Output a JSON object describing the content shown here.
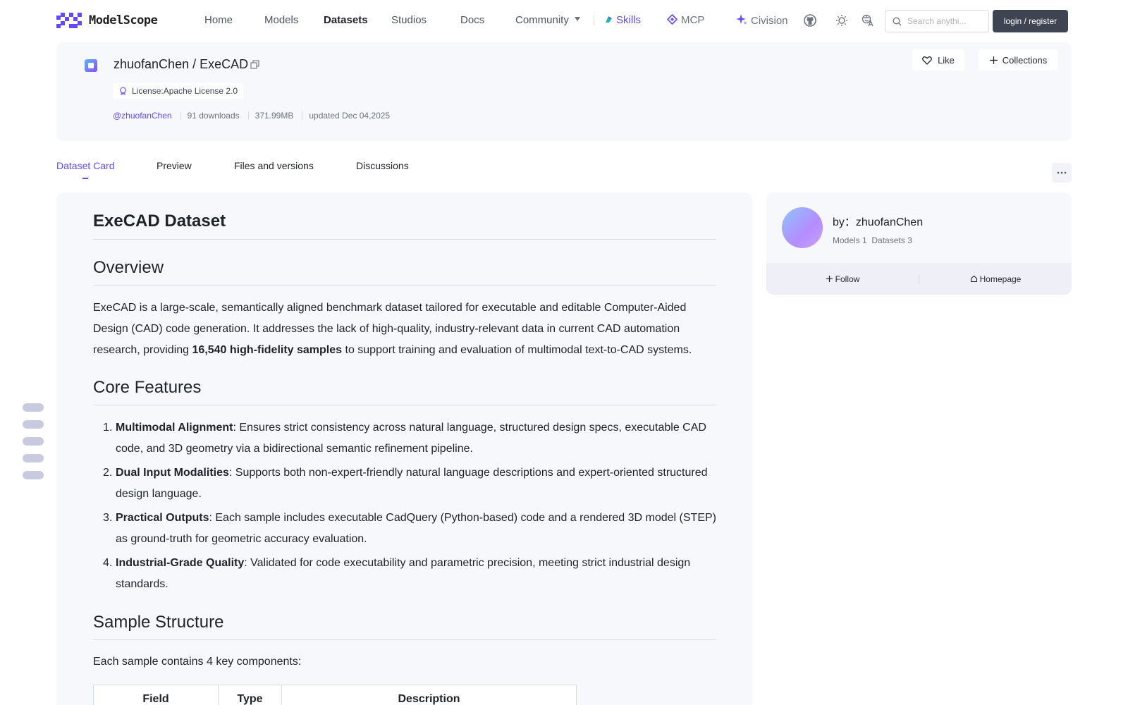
{
  "brand": {
    "name": "ModelScope",
    "accent": "#624aff"
  },
  "nav": {
    "home": "Home",
    "models": "Models",
    "datasets": "Datasets",
    "studios": "Studios",
    "docs": "Docs",
    "community": "Community",
    "skills": "Skills",
    "mcp": "MCP",
    "civision": "Civision",
    "search_placeholder": "Search anythi...",
    "login": "login / register"
  },
  "header": {
    "owner": "zhuofanChen",
    "separator": "/",
    "name": "ExeCAD",
    "license": "License:Apache License 2.0",
    "author_link": "@zhuofanChen",
    "downloads": "91 downloads",
    "size": "371.99MB",
    "updated": "updated Dec 04,2025",
    "like_label": "Like",
    "collections_label": "Collections"
  },
  "tabs": [
    {
      "label": "Dataset Card",
      "active": true
    },
    {
      "label": "Preview"
    },
    {
      "label": "Files and versions"
    },
    {
      "label": "Discussions"
    }
  ],
  "readme": {
    "title": "ExeCAD Dataset",
    "overview_heading": "Overview",
    "overview_before": "ExeCAD is a large-scale, semantically aligned benchmark dataset tailored for executable and editable Computer-Aided Design (CAD) code generation. It addresses the lack of high-quality, industry-relevant data in current CAD automation research, providing ",
    "overview_bold": "16,540 high-fidelity samples",
    "overview_after": " to support training and evaluation of multimodal text-to-CAD systems.",
    "features_heading": "Core Features",
    "features": [
      {
        "num": "1.",
        "title": "Multimodal Alignment",
        "text": ": Ensures strict consistency across natural language, structured design specs, executable CAD code, and 3D geometry via a bidirectional semantic refinement pipeline."
      },
      {
        "num": "2.",
        "title": "Dual Input Modalities",
        "text": ": Supports both non-expert-friendly natural language descriptions and expert-oriented structured design language."
      },
      {
        "num": "3.",
        "title": "Practical Outputs",
        "text": ": Each sample includes executable CadQuery (Python-based) code and a rendered 3D model (STEP) as ground-truth for geometric accuracy evaluation."
      },
      {
        "num": "4.",
        "title": "Industrial-Grade Quality",
        "text": ": Validated for code executability and parametric precision, meeting strict industrial design standards."
      }
    ],
    "structure_heading": "Sample Structure",
    "structure_text": "Each sample contains 4 key components:",
    "table_headers": [
      "Field",
      "Type",
      "Description"
    ]
  },
  "author": {
    "by_label": "by：",
    "name": "zhuofanChen",
    "models": "Models 1",
    "datasets": "Datasets 3",
    "follow": "Follow",
    "homepage": "Homepage"
  }
}
